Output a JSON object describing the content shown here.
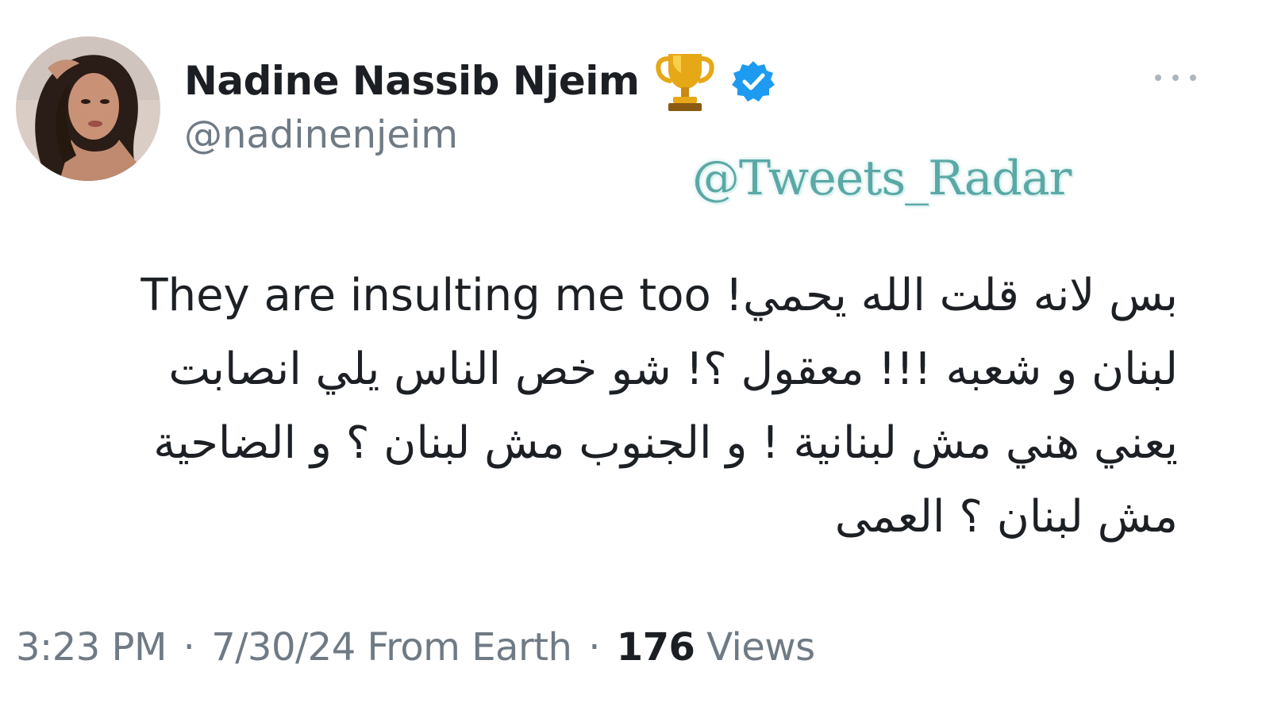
{
  "author": {
    "display_name": "Nadine Nassib Njeim",
    "handle": "@nadinenjeim",
    "badge_icons": [
      "trophy-icon",
      "verified-icon"
    ]
  },
  "watermark": "@Tweets_Radar",
  "tweet": {
    "lines": [
      "بس لانه قلت الله يحمي! They are insulting me too",
      "لبنان و شعبه !!! معقول ؟! شو خص الناس يلي انصابت",
      "يعني هني مش لبنانية ! و الجنوب مش لبنان ؟ و الضاحية",
      "مش لبنان ؟ العمى"
    ]
  },
  "meta": {
    "time": "3:23 PM",
    "separator": "·",
    "date": "7/30/24",
    "source": "From Earth",
    "views_count": "176",
    "views_label": "Views"
  },
  "colors": {
    "text_primary": "#0f1419",
    "text_secondary": "#6f7a84",
    "verified_blue": "#1d9bf0",
    "watermark": "#5aa9a6",
    "trophy_gold": "#e6a817"
  }
}
